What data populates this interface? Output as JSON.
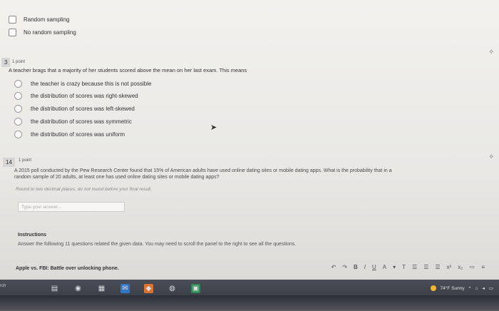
{
  "previous_question": {
    "options": [
      "Random sampling",
      "No random sampling"
    ]
  },
  "question13": {
    "number": "3",
    "points": "1 point",
    "text": "A teacher brags that a majority of her students scored above the mean on her last exam. This means",
    "options": [
      "the teacher is crazy because this is not possible",
      "the distribution of scores was right-skewed",
      "the distribution of scores was left-skewed",
      "the distribution of scores was symmetric",
      "the distribution of scores was uniform"
    ]
  },
  "question14": {
    "number": "14",
    "points": "1 point",
    "text_line1": "A 2015 poll conducted by the Pew Research Center found that 15% of American adults have used online dating sites or mobile dating apps. What is the probability that in a",
    "text_line2": "random sample of 20 adults, at least one has used online dating sites or mobile dating apps?",
    "hint": "Round to two decimal places, do not round before your final result.",
    "placeholder": "Type your answer..."
  },
  "instructions": {
    "title": "Instructions",
    "text": "Answer the following 11 questions related the given data. You may need to scroll the panel to the right to see all the questions."
  },
  "document": {
    "title": "Apple vs. FBI: Battle over unlocking phone."
  },
  "editor_toolbar": [
    "B",
    "I",
    "U",
    "A",
    "T"
  ],
  "taskbar": {
    "search_label": "rch",
    "weather": "74°F Sunny"
  },
  "colors": {
    "taskbar": "#34373f",
    "page": "#efeeeb"
  }
}
